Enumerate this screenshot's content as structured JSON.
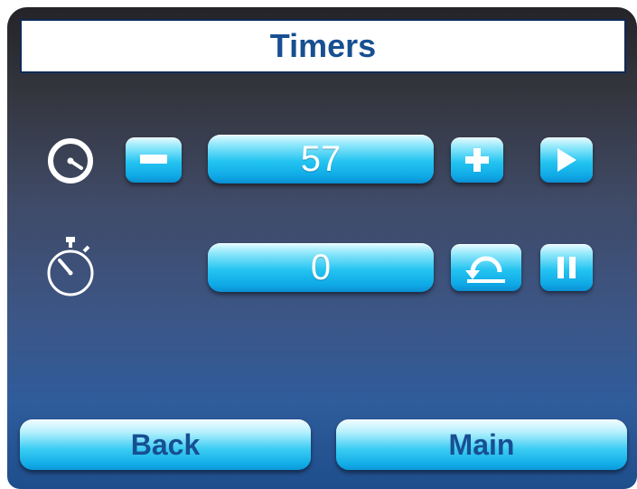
{
  "screen": {
    "title": "Timers"
  },
  "countdown": {
    "icon": "countdown-timer-icon",
    "value": "57",
    "decrease_icon": "minus-icon",
    "increase_icon": "plus-icon",
    "start_icon": "play-icon"
  },
  "stopwatch": {
    "icon": "stopwatch-icon",
    "value": "0",
    "reset_icon": "reset-icon",
    "pause_icon": "pause-icon"
  },
  "nav": {
    "back_label": "Back",
    "main_label": "Main"
  },
  "colors": {
    "title_text": "#184f92",
    "button_cyan": "#23c4f1",
    "panel_top": "#242428",
    "panel_bottom": "#1f4e8c"
  }
}
